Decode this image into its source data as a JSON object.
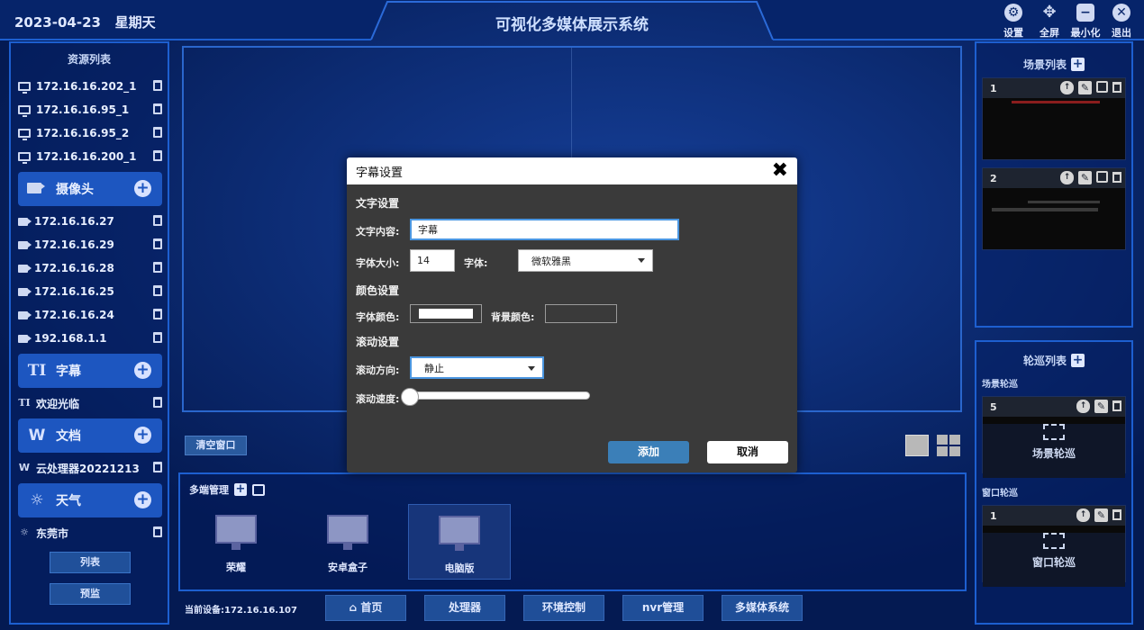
{
  "header": {
    "date": "2023-04-23",
    "weekday": "星期天",
    "title": "可视化多媒体展示系统",
    "buttons": [
      {
        "label": "设置",
        "icon": "gear-icon"
      },
      {
        "label": "全屏",
        "icon": "fullscreen-icon"
      },
      {
        "label": "最小化",
        "icon": "minimize-icon"
      },
      {
        "label": "退出",
        "icon": "close-circle-icon"
      }
    ]
  },
  "resources": {
    "title": "资源列表",
    "screens": [
      "172.16.16.202_1",
      "172.16.16.95_1",
      "172.16.16.95_2",
      "172.16.16.200_1"
    ],
    "camera": {
      "label": "摄像头",
      "items": [
        "172.16.16.27",
        "172.16.16.29",
        "172.16.16.28",
        "172.16.16.25",
        "172.16.16.24",
        "192.168.1.1"
      ]
    },
    "subtitle": {
      "label": "字幕",
      "items": [
        "欢迎光临"
      ]
    },
    "document": {
      "label": "文档",
      "items": [
        "云处理器20221213"
      ]
    },
    "weather": {
      "label": "天气",
      "items": [
        "东莞市"
      ]
    },
    "btn_list": "列表",
    "btn_preview": "预监"
  },
  "center": {
    "clear_button": "清空窗口",
    "multi_title": "多端管理",
    "devices": [
      {
        "label": "荣耀",
        "selected": false
      },
      {
        "label": "安卓盒子",
        "selected": false
      },
      {
        "label": "电脑版",
        "selected": true
      }
    ],
    "current_device_label": "当前设备:172.16.16.107",
    "nav": [
      "首页",
      "处理器",
      "环境控制",
      "nvr管理",
      "多媒体系统"
    ]
  },
  "scenes": {
    "title": "场景列表",
    "items": [
      {
        "index": "1"
      },
      {
        "index": "2"
      }
    ]
  },
  "tours": {
    "title": "轮巡列表",
    "scene_tour_label": "场景轮巡",
    "scene_tour": {
      "index": "5",
      "name": "场景轮巡"
    },
    "window_tour_label": "窗口轮巡",
    "window_tour": {
      "index": "1",
      "name": "窗口轮巡"
    }
  },
  "modal": {
    "title": "字幕设置",
    "section_text": "文字设置",
    "content_label": "文字内容:",
    "content_value": "字幕",
    "size_label": "字体大小:",
    "size_value": "14",
    "font_label": "字体:",
    "font_value": "微软雅黑",
    "section_color": "颜色设置",
    "font_color_label": "字体颜色:",
    "font_color": "#ffffff",
    "bg_color_label": "背景颜色:",
    "section_scroll": "滚动设置",
    "direction_label": "滚动方向:",
    "direction_value": "静止",
    "speed_label": "滚动速度:",
    "speed_value": 0,
    "add_button": "添加",
    "cancel_button": "取消"
  },
  "colors": {
    "background": "#041a52",
    "panel_border": "#1d5fd0",
    "category": "#1d56c0",
    "primary_button": "#3b7fb8"
  }
}
